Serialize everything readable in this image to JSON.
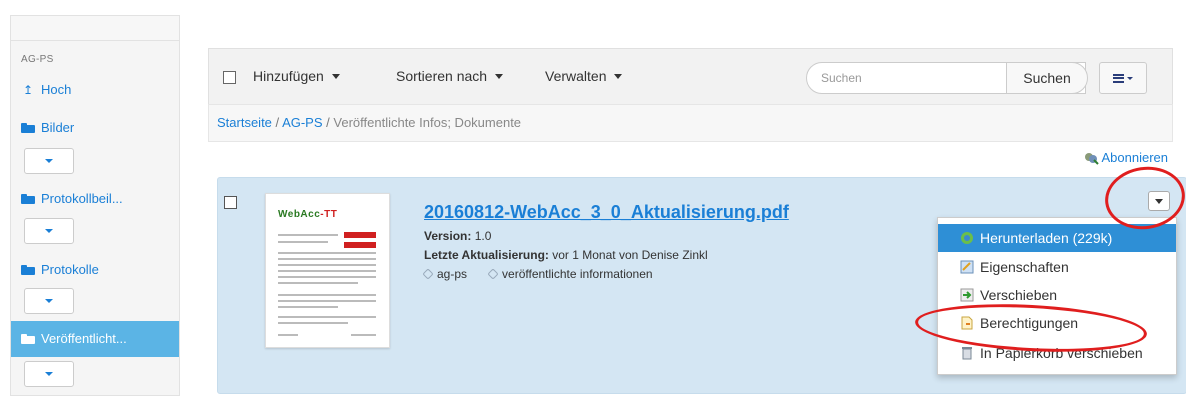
{
  "sidebar": {
    "section_label": "AG-PS",
    "items": [
      {
        "label": "Hoch",
        "icon": "arrow-up-icon"
      },
      {
        "label": "Bilder",
        "icon": "folder-icon"
      },
      {
        "label": "Protokollbeil...",
        "icon": "folder-icon"
      },
      {
        "label": "Protokolle",
        "icon": "folder-icon"
      },
      {
        "label": "Veröffentlicht...",
        "icon": "folder-icon",
        "active": true
      }
    ]
  },
  "toolbar": {
    "add_label": "Hinzufügen",
    "sort_label": "Sortieren nach",
    "manage_label": "Verwalten",
    "search_placeholder": "Suchen",
    "search_button": "Suchen"
  },
  "breadcrumb": {
    "home": "Startseite",
    "site": "AG-PS",
    "current": "Veröffentlichte Infos; Dokumente"
  },
  "subscribe_label": "Abonnieren",
  "document": {
    "title": "20160812-WebAcc_3_0_Aktualisierung.pdf",
    "version_label": "Version:",
    "version_value": "1.0",
    "updated_label": "Letzte Aktualisierung:",
    "updated_value": "vor 1 Monat von Denise Zinkl",
    "tags": [
      "ag-ps",
      "veröffentlichte informationen"
    ],
    "thumbnail_logo": "WebAcc"
  },
  "action_menu": {
    "items": [
      {
        "label": "Herunterladen (229k)",
        "icon": "download-icon",
        "active": true
      },
      {
        "label": "Eigenschaften",
        "icon": "properties-icon"
      },
      {
        "label": "Verschieben",
        "icon": "move-icon"
      },
      {
        "label": "Berechtigungen",
        "icon": "permissions-icon"
      },
      {
        "label": "In Papierkorb verschieben",
        "icon": "trash-icon"
      }
    ]
  },
  "colors": {
    "link": "#1a7fd6",
    "sidebar_active": "#5bb4e5",
    "doc_panel": "#d4e6f3",
    "menu_active": "#2e8fd6",
    "annotation": "#e01e1e"
  }
}
